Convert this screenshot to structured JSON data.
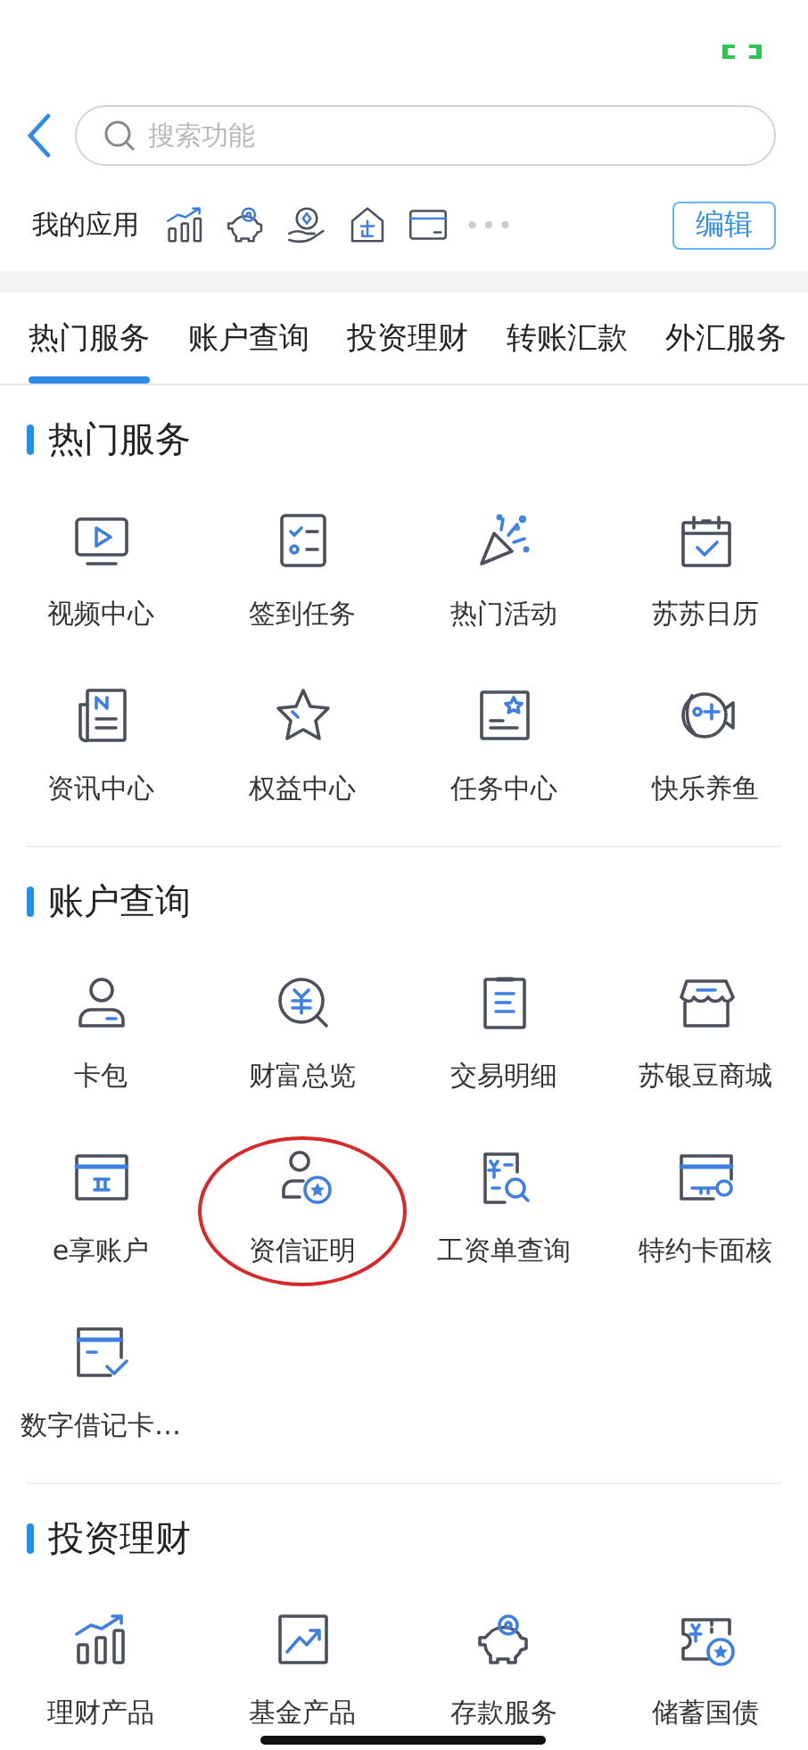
{
  "search": {
    "placeholder": "搜索功能"
  },
  "my_apps": {
    "label": "我的应用",
    "edit_button": "编辑"
  },
  "tabs": [
    {
      "label": "热门服务",
      "selected": true
    },
    {
      "label": "账户查询",
      "selected": false
    },
    {
      "label": "投资理财",
      "selected": false
    },
    {
      "label": "转账汇款",
      "selected": false
    },
    {
      "label": "外汇服务",
      "selected": false
    }
  ],
  "sections": [
    {
      "title": "热门服务",
      "items": [
        {
          "label": "视频中心",
          "circled": false
        },
        {
          "label": "签到任务",
          "circled": false
        },
        {
          "label": "热门活动",
          "circled": false
        },
        {
          "label": "苏苏日历",
          "circled": false
        },
        {
          "label": "资讯中心",
          "circled": false
        },
        {
          "label": "权益中心",
          "circled": false
        },
        {
          "label": "任务中心",
          "circled": false
        },
        {
          "label": "快乐养鱼",
          "circled": false
        }
      ]
    },
    {
      "title": "账户查询",
      "items": [
        {
          "label": "卡包",
          "circled": false
        },
        {
          "label": "财富总览",
          "circled": false
        },
        {
          "label": "交易明细",
          "circled": false
        },
        {
          "label": "苏银豆商城",
          "circled": false
        },
        {
          "label": "e享账户",
          "circled": false
        },
        {
          "label": "资信证明",
          "circled": true
        },
        {
          "label": "工资单查询",
          "circled": false
        },
        {
          "label": "特约卡面核",
          "circled": false
        },
        {
          "label": "数字借记卡…",
          "circled": false
        }
      ]
    },
    {
      "title": "投资理财",
      "items": [
        {
          "label": "理财产品",
          "circled": false
        },
        {
          "label": "基金产品",
          "circled": false
        },
        {
          "label": "存款服务",
          "circled": false
        },
        {
          "label": "储蓄国债",
          "circled": false
        }
      ]
    }
  ]
}
